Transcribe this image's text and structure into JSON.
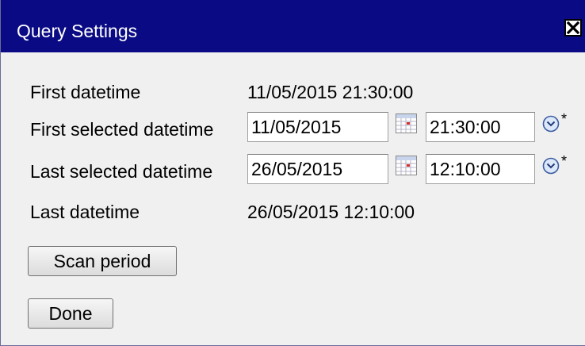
{
  "dialog": {
    "title": "Query Settings"
  },
  "rows": {
    "first_datetime": {
      "label": "First datetime",
      "value": "11/05/2015 21:30:00"
    },
    "first_selected": {
      "label": "First selected datetime",
      "date": "11/05/2015",
      "time": "21:30:00",
      "clock_suffix": "*"
    },
    "last_selected": {
      "label": "Last selected datetime",
      "date": "26/05/2015",
      "time": "12:10:00",
      "clock_suffix": "*"
    },
    "last_datetime": {
      "label": "Last datetime",
      "value": "26/05/2015 12:10:00"
    }
  },
  "buttons": {
    "scan_period": "Scan period",
    "done": "Done"
  },
  "icons": {
    "close": "close-icon",
    "calendar": "calendar-icon",
    "clock": "clock-icon"
  },
  "colors": {
    "titlebar": "#0a0a84",
    "dialog_bg": "#f0f0f0"
  }
}
